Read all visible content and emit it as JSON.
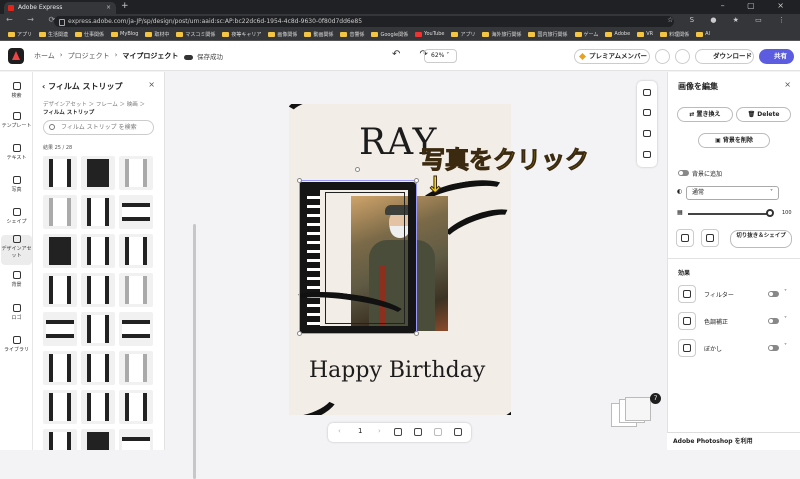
{
  "browser": {
    "tab_title": "Adobe Express",
    "url": "express.adobe.com/ja-JP/sp/design/post/urn:aaid:sc:AP:bc22dc6d-1954-4c8d-9630-0f80d7dd6e85",
    "bookmarks": [
      "アプリ",
      "生活関連",
      "仕事関係",
      "MyBlog",
      "取材中",
      "マスコミ関係",
      "夜等キャリア",
      "画像関係",
      "動画関係",
      "音響係",
      "Google関係",
      "YouTube",
      "アプリ",
      "海外旅行関係",
      "国内旅行関係",
      "ゲーム",
      "Adobe",
      "VR",
      "料理関係",
      "AI"
    ]
  },
  "header": {
    "breadcrumb": [
      "ホーム",
      "プロジェクト",
      "マイプロジェクト"
    ],
    "save_status": "保存成功",
    "zoom": "62%",
    "premium": "プレミアムメンバー",
    "download": "ダウンロード",
    "share": "共有"
  },
  "rail": [
    "検索",
    "テンプレート",
    "テキスト",
    "写真",
    "シェイプ",
    "デザインアセット",
    "背景",
    "ロゴ",
    "ライブラリ"
  ],
  "left_panel": {
    "title": "フィルム ストリップ",
    "crumb": "デザインアセット ＞ フレーム ＞ 映画 ＞",
    "crumb_current": "フィルム ストリップ",
    "search_placeholder": "フィルム ストリップ を検索",
    "count": "結果 25 / 28"
  },
  "canvas": {
    "name_text": "RAY",
    "greeting": "Happy Birthday"
  },
  "annotation": {
    "instruction": "写真をクリック",
    "arrow": "↓"
  },
  "pager": {
    "page": "1"
  },
  "page_count_badge": "7",
  "right_panel": {
    "title": "画像を編集",
    "replace": "置き換え",
    "delete": "Delete",
    "remove_bg": "背景を削除",
    "add_bg": "背景に追加",
    "blend_mode": "通常",
    "opacity": "100",
    "crop": "切り抜き＆シェイプ",
    "effects_title": "効果",
    "effects": [
      "フィルター",
      "色調補正",
      "ぼかし"
    ],
    "photoshop": "Adobe Photoshop を利用"
  },
  "colors": {
    "share": "#5c5ce0",
    "annotation": "#f5d31a",
    "canvas_bg": "#f2ede6"
  }
}
